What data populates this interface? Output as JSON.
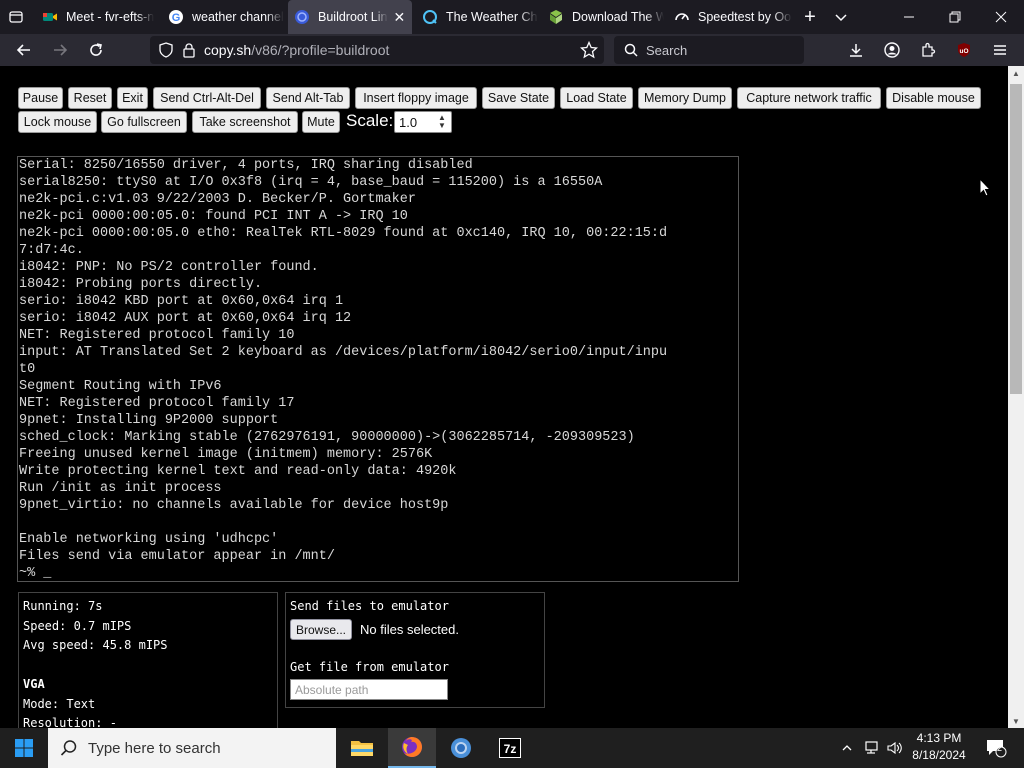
{
  "browser": {
    "tabs": [
      {
        "label": "Meet - fvr-efts-n",
        "icon": "google-meet-icon",
        "active": false
      },
      {
        "label": "weather channel",
        "icon": "google-icon",
        "active": false
      },
      {
        "label": "Buildroot Lin",
        "icon": "v86-icon",
        "active": true
      },
      {
        "label": "The Weather Cha",
        "icon": "weather-channel-icon",
        "active": false
      },
      {
        "label": "Download The W",
        "icon": "download-site-icon",
        "active": false
      },
      {
        "label": "Speedtest by Ool",
        "icon": "speedtest-icon",
        "active": false
      }
    ],
    "url_domain": "copy.sh",
    "url_path": "/v86/?profile=buildroot",
    "search_placeholder": "Search"
  },
  "controls": {
    "row1": [
      "Pause",
      "Reset",
      "Exit",
      "Send Ctrl-Alt-Del",
      "Send Alt-Tab",
      "Insert floppy image",
      "Save State",
      "Load State",
      "Memory Dump",
      "Capture network traffic",
      "Disable mouse"
    ],
    "row2": [
      "Lock mouse",
      "Go fullscreen",
      "Take screenshot",
      "Mute"
    ],
    "scale_label": "Scale:",
    "scale_value": "1.0"
  },
  "terminal": {
    "lines": [
      "Serial: 8250/16550 driver, 4 ports, IRQ sharing disabled",
      "serial8250: ttyS0 at I/O 0x3f8 (irq = 4, base_baud = 115200) is a 16550A",
      "ne2k-pci.c:v1.03 9/22/2003 D. Becker/P. Gortmaker",
      "ne2k-pci 0000:00:05.0: found PCI INT A -> IRQ 10",
      "ne2k-pci 0000:00:05.0 eth0: RealTek RTL-8029 found at 0xc140, IRQ 10, 00:22:15:d",
      "7:d7:4c.",
      "i8042: PNP: No PS/2 controller found.",
      "i8042: Probing ports directly.",
      "serio: i8042 KBD port at 0x60,0x64 irq 1",
      "serio: i8042 AUX port at 0x60,0x64 irq 12",
      "NET: Registered protocol family 10",
      "input: AT Translated Set 2 keyboard as /devices/platform/i8042/serio0/input/inpu",
      "t0",
      "Segment Routing with IPv6",
      "NET: Registered protocol family 17",
      "9pnet: Installing 9P2000 support",
      "sched_clock: Marking stable (2762976191, 90000000)->(3062285714, -209309523)",
      "Freeing unused kernel image (initmem) memory: 2576K",
      "Write protecting kernel text and read-only data: 4920k",
      "Run /init as init process",
      "9pnet_virtio: no channels available for device host9p",
      "",
      "Enable networking using 'udhcpc'",
      "Files send via emulator appear in /mnt/",
      "~% _"
    ]
  },
  "info": {
    "running": "Running: 7s",
    "speed": "Speed: 0.7 mIPS",
    "avg_speed": "Avg speed: 45.8 mIPS",
    "vga_heading": "VGA",
    "mode": "Mode: Text",
    "resolution": "Resolution: -"
  },
  "files": {
    "send_label": "Send files to emulator",
    "browse_label": "Browse...",
    "no_file": "No files selected.",
    "get_label": "Get file from emulator",
    "path_placeholder": "Absolute path"
  },
  "taskbar": {
    "search_placeholder": "Type here to search",
    "time": "4:13 PM",
    "date": "8/18/2024",
    "notification_count": "2",
    "apps": [
      "file-explorer-icon",
      "firefox-icon",
      "chrome-icon",
      "7zip-icon"
    ]
  }
}
